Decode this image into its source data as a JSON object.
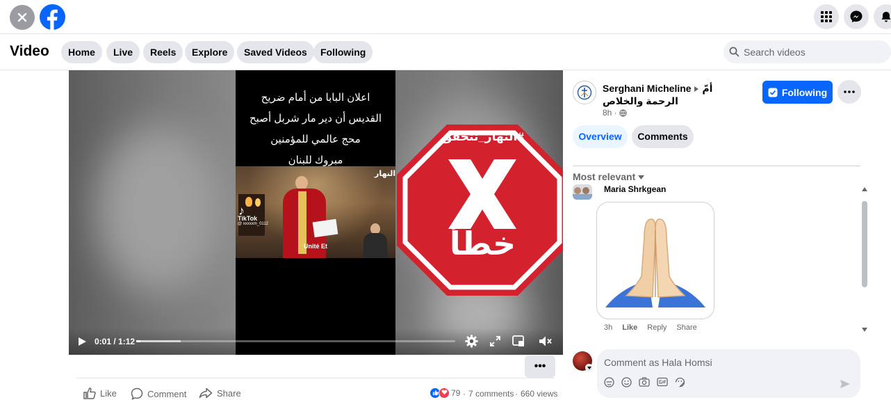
{
  "topbar": {
    "close_icon": "close-icon",
    "logo_icon": "facebook-logo",
    "menu_icon": "grid-menu-icon",
    "messenger_icon": "messenger-icon",
    "notifications_icon": "bell-icon"
  },
  "video_header": {
    "title": "Video",
    "nav": [
      "Home",
      "Live",
      "Reels",
      "Explore",
      "Saved Videos",
      "Following"
    ],
    "search_placeholder": "Search videos"
  },
  "player": {
    "caption_lines": [
      "اعلان البابا من أمام ضريح",
      "القديس أن دير مار شربل أصبح",
      "محج عالمي للمؤمنين",
      "مبروك للبنان"
    ],
    "tiktok_label": "TikTok",
    "tiktok_handle": "@ xxxxxm_0112",
    "subtitle": "Unité Et",
    "corner_watermark": "النهار",
    "stop_sign_hashtag": "#النهار_تتحقق",
    "stop_sign_verdict": "خطأ",
    "time": "0:01 / 1:12",
    "progress_fraction": 0.014,
    "buffer_fraction": 0.14
  },
  "actions": {
    "more_label": "•••",
    "like": "Like",
    "comment": "Comment",
    "share": "Share",
    "reaction_count": "79",
    "comments_count": "7 comments",
    "views": "660 views",
    "separator": "·"
  },
  "post": {
    "author": "Serghani Micheline",
    "group": "أمّ الرحمة والخلاص",
    "time": "8h ·",
    "follow_label": "Following",
    "tabs": [
      "Overview",
      "Comments"
    ],
    "sort_label": "Most relevant",
    "comment": {
      "name": "Maria Shrkgean",
      "time": "3h",
      "like": "Like",
      "reply": "Reply",
      "share": "Share"
    },
    "comment_placeholder": "Comment as Hala Homsi"
  },
  "colors": {
    "brand": "#0866ff",
    "stop_red": "#d3212d"
  }
}
